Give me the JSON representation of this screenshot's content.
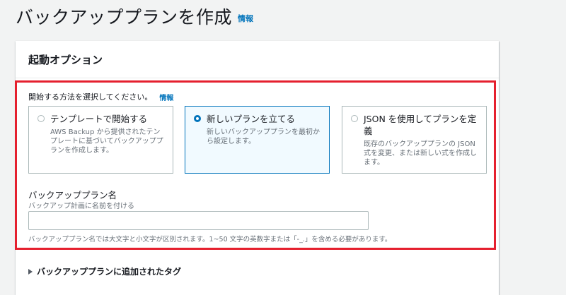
{
  "page": {
    "title": "バックアッププランを作成",
    "info_label": "情報"
  },
  "startup": {
    "title": "起動オプション",
    "prompt": "開始する方法を選択してください。",
    "prompt_info": "情報",
    "options": [
      {
        "title": "テンプレートで開始する",
        "description": "AWS Backup から提供されたテンプレートに基づいてバックアッププランを作成します。",
        "selected": false
      },
      {
        "title": "新しいプランを立てる",
        "description": "新しいバックアッププランを最初から設定します。",
        "selected": true
      },
      {
        "title": "JSON を使用してプランを定義",
        "description": "既存のバックアッププランの JSON 式を変更、または新しい式を作成します。",
        "selected": false
      }
    ]
  },
  "plan_name": {
    "label": "バックアッププラン名",
    "description": "バックアップ計画に名前を付ける",
    "value": "",
    "constraint": "バックアッププラン名では大文字と小文字が区別されます。1~50 文字の英数字または「-_.」を含める必要があります。"
  },
  "tags": {
    "label": "バックアッププランに追加されたタグ",
    "expanded": false
  },
  "colors": {
    "highlight": "#e5202e",
    "link": "#0073bb",
    "selected_bg": "#f1faff"
  }
}
